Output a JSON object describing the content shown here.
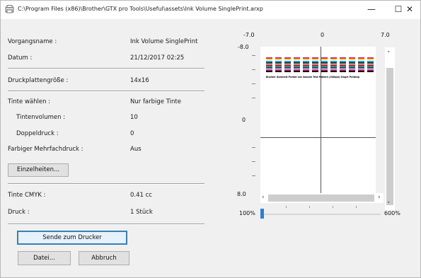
{
  "window": {
    "title": "C:\\Program Files (x86)\\Brother\\GTX pro Tools\\Useful\\assets\\Ink Volume SinglePrint.arxp",
    "controls": {
      "minimize": "—",
      "maximize": "☐",
      "close": "✕"
    }
  },
  "job": {
    "name_label": "Vorgangsname :",
    "name_value": "Ink Volume SinglePrint",
    "date_label": "Datum :",
    "date_value": "21/12/2017 02:25",
    "platen_label": "Druckplattengröße :",
    "platen_value": "14x16",
    "ink_label": "Tinte wählen :",
    "ink_value": "Nur farbige Tinte",
    "volume_label": "Tintenvolumen :",
    "volume_value": "10",
    "double_label": "Doppeldruck :",
    "double_value": "0",
    "multipass_label": "Farbiger Mehrfachdruck :",
    "multipass_value": "Aus",
    "details_button": "Einzelheiten...",
    "cmyk_label": "Tinte CMYK :",
    "cmyk_value": "0.41 cc",
    "print_label": "Druck :",
    "print_value": "1 Stück"
  },
  "actions": {
    "send_button": "Sende zum Drucker",
    "file_button": "Datei...",
    "cancel_button": "Abbruch"
  },
  "preview": {
    "x_min": "-7.0",
    "x_mid": "0",
    "x_max": "7.0",
    "y_top": "-8.0",
    "y_mid": "0",
    "y_bottom": "8.0",
    "pattern_caption": "Brother Garment Printer Ink Volume Test Pattern (300dpi)   Single Printing"
  },
  "zoom": {
    "min_label": "100%",
    "max_label": "600%",
    "level_percent": 100
  },
  "colors": {
    "accent": "#2d7fd4",
    "default_button_border": "#3c7fb1"
  }
}
